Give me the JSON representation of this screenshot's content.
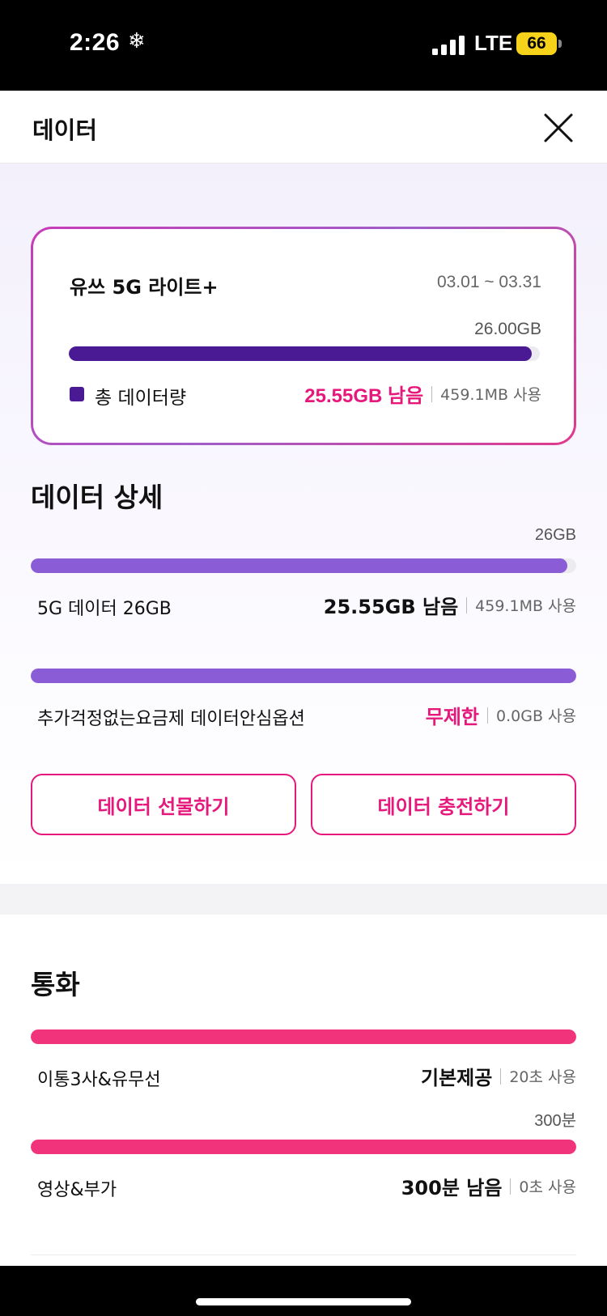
{
  "status_bar": {
    "time": "2:26",
    "network": "LTE",
    "battery": "66"
  },
  "header": {
    "title": "데이터"
  },
  "plan": {
    "name": "유쓰 5G 라이트+",
    "period": "03.01 ~ 03.31",
    "total": "26.00GB",
    "used_fraction": 0.983,
    "legend_label": "총 데이터량",
    "remaining": "25.55GB 남음",
    "used": "459.1MB 사용",
    "bar_color": "#4a1a94"
  },
  "data_detail": {
    "title": "데이터 상세",
    "items": [
      {
        "cap": "26GB",
        "label": "5G 데이터 26GB",
        "value": "25.55GB 남음",
        "used": "459.1MB 사용",
        "fill_fraction": 0.983
      },
      {
        "cap": "",
        "label": "추가걱정없는요금제 데이터안심옵션",
        "value": "무제한",
        "used": "0.0GB 사용",
        "fill_fraction": 1.0
      }
    ],
    "bar_color": "#8a5cd6"
  },
  "buttons": {
    "gift": "데이터 선물하기",
    "charge": "데이터 충전하기"
  },
  "call": {
    "title": "통화",
    "items": [
      {
        "cap": "",
        "label": "이통3사&유무선",
        "value": "기본제공",
        "used": "20초 사용",
        "fill_fraction": 1.0
      },
      {
        "cap": "300분",
        "label": "영상&부가",
        "value": "300분 남음",
        "used": "0초 사용",
        "fill_fraction": 1.0
      }
    ],
    "bar_color": "#f0337a"
  },
  "colors": {
    "accent_pink": "#e6187c"
  }
}
